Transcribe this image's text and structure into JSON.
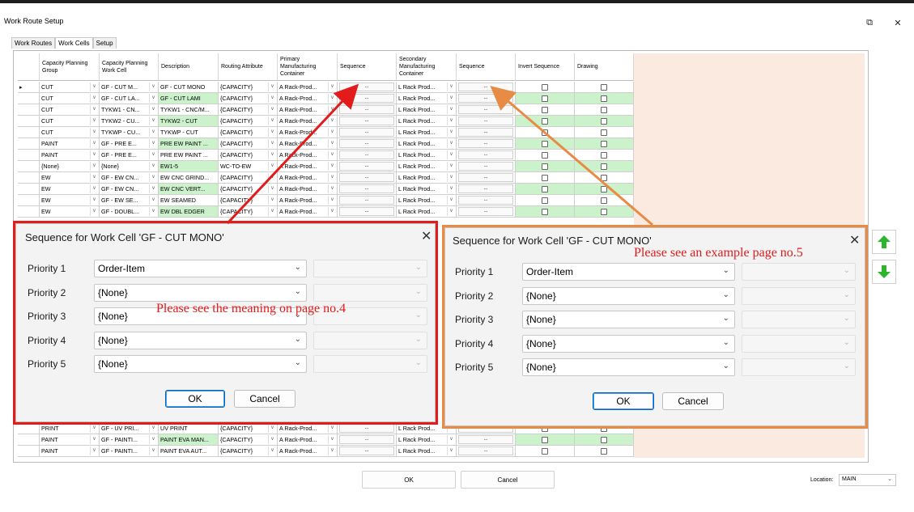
{
  "window": {
    "title": "Work Route Setup",
    "maximize_glyph": "⧉",
    "close_glyph": "✕"
  },
  "tabs": [
    "Work Routes",
    "Work Cells",
    "Setup"
  ],
  "active_tab": "Work Cells",
  "grid": {
    "headers": [
      "Capacity Planning Group",
      "Capacity Planning Work Cell",
      "Description",
      "Routing Attribute",
      "Primary Manufacturing Container",
      "Sequence",
      "Secondary Manufacturing Container",
      "Sequence",
      "Invert Sequence",
      "Drawing"
    ],
    "seq_button_text": "...",
    "row_indicator": "▸",
    "dd_glyph": "v",
    "rows_top": [
      {
        "group": "CUT",
        "cell": "GF - CUT M...",
        "desc": "GF - CUT MONO",
        "attr": "{CAPACITY}",
        "primary": "A Rack-Prod...",
        "secondary": "L Rack Prod...",
        "green": false
      },
      {
        "group": "CUT",
        "cell": "GF - CUT LA...",
        "desc": "GF - CUT LAMI",
        "attr": "{CAPACITY}",
        "primary": "A Rack-Prod...",
        "secondary": "L Rack Prod...",
        "green": true
      },
      {
        "group": "CUT",
        "cell": "TYKW1 - CN...",
        "desc": "TYKW1 - CNC/M...",
        "attr": "{CAPACITY}",
        "primary": "A Rack-Prod...",
        "secondary": "L Rack Prod...",
        "green": false
      },
      {
        "group": "CUT",
        "cell": "TYKW2 - CU...",
        "desc": "TYKW2 - CUT",
        "attr": "{CAPACITY}",
        "primary": "A Rack-Prod...",
        "secondary": "L Rack Prod...",
        "green": true
      },
      {
        "group": "CUT",
        "cell": "TYKWP - CU...",
        "desc": "TYKWP - CUT",
        "attr": "{CAPACITY}",
        "primary": "A Rack-Prod...",
        "secondary": "L Rack Prod...",
        "green": false
      },
      {
        "group": "PAINT",
        "cell": "GF - PRE E...",
        "desc": "PRE EW PAINT ...",
        "attr": "{CAPACITY}",
        "primary": "A Rack-Prod...",
        "secondary": "L Rack Prod...",
        "green": true
      },
      {
        "group": "PAINT",
        "cell": "GF - PRE E...",
        "desc": "PRE EW PAINT ...",
        "attr": "{CAPACITY}",
        "primary": "A Rack-Prod...",
        "secondary": "L Rack Prod...",
        "green": false
      },
      {
        "group": "{None}",
        "cell": "{None}",
        "desc": "EW1-5",
        "attr": "WC-TO-EW",
        "primary": "A Rack-Prod...",
        "secondary": "L Rack Prod...",
        "green": true
      },
      {
        "group": "EW",
        "cell": "GF - EW CN...",
        "desc": "EW CNC GRIND...",
        "attr": "{CAPACITY}",
        "primary": "A Rack-Prod...",
        "secondary": "L Rack Prod...",
        "green": false
      },
      {
        "group": "EW",
        "cell": "GF - EW CN...",
        "desc": "EW CNC VERT...",
        "attr": "{CAPACITY}",
        "primary": "A Rack-Prod...",
        "secondary": "L Rack Prod...",
        "green": true
      },
      {
        "group": "EW",
        "cell": "GF - EW SE...",
        "desc": "EW SEAMED",
        "attr": "{CAPACITY}",
        "primary": "A Rack-Prod...",
        "secondary": "L Rack Prod...",
        "green": false
      },
      {
        "group": "EW",
        "cell": "GF - DOUBL...",
        "desc": "EW DBL EDGER",
        "attr": "{CAPACITY}",
        "primary": "A Rack-Prod...",
        "secondary": "L Rack Prod...",
        "green": true
      }
    ],
    "rows_bottom": [
      {
        "group": "PRINT",
        "cell": "GF - UV PRI...",
        "desc": "UV PRINT",
        "attr": "{CAPACITY}",
        "primary": "A Rack-Prod...",
        "secondary": "L Rack Prod...",
        "green": false
      },
      {
        "group": "PAINT",
        "cell": "GF - PAINTI...",
        "desc": "PAINT EVA MAN...",
        "attr": "{CAPACITY}",
        "primary": "A Rack-Prod...",
        "secondary": "L Rack Prod...",
        "green": true
      },
      {
        "group": "PAINT",
        "cell": "GF - PAINTI...",
        "desc": "PAINT EVA AUT...",
        "attr": "{CAPACITY}",
        "primary": "A Rack-Prod...",
        "secondary": "L Rack Prod...",
        "green": false
      }
    ]
  },
  "dialog_left": {
    "title": "Sequence for Work Cell 'GF - CUT MONO'",
    "labels": [
      "Priority 1",
      "Priority 2",
      "Priority 3",
      "Priority 4",
      "Priority 5"
    ],
    "values": [
      "Order-Item",
      "{None}",
      "{None}",
      "{None}",
      "{None}"
    ],
    "ok": "OK",
    "cancel": "Cancel",
    "annotation": "Please see the meaning on page no.4"
  },
  "dialog_right": {
    "title": "Sequence for Work Cell 'GF - CUT MONO'",
    "labels": [
      "Priority 1",
      "Priority 2",
      "Priority 3",
      "Priority 4",
      "Priority 5"
    ],
    "values": [
      "Order-Item",
      "{None}",
      "{None}",
      "{None}",
      "{None}"
    ],
    "ok": "OK",
    "cancel": "Cancel",
    "annotation": "Please see an example page no.5"
  },
  "colors": {
    "red": "#e31b1b",
    "orange": "#e88b44",
    "green_cell": "#ccf2cc",
    "up_arrow": "#2db52d"
  },
  "footer": {
    "ok": "OK",
    "cancel": "Cancel",
    "location_label": "Location:",
    "location_value": "MAIN"
  },
  "side_buttons": {
    "up": "▲",
    "down": "▼"
  }
}
